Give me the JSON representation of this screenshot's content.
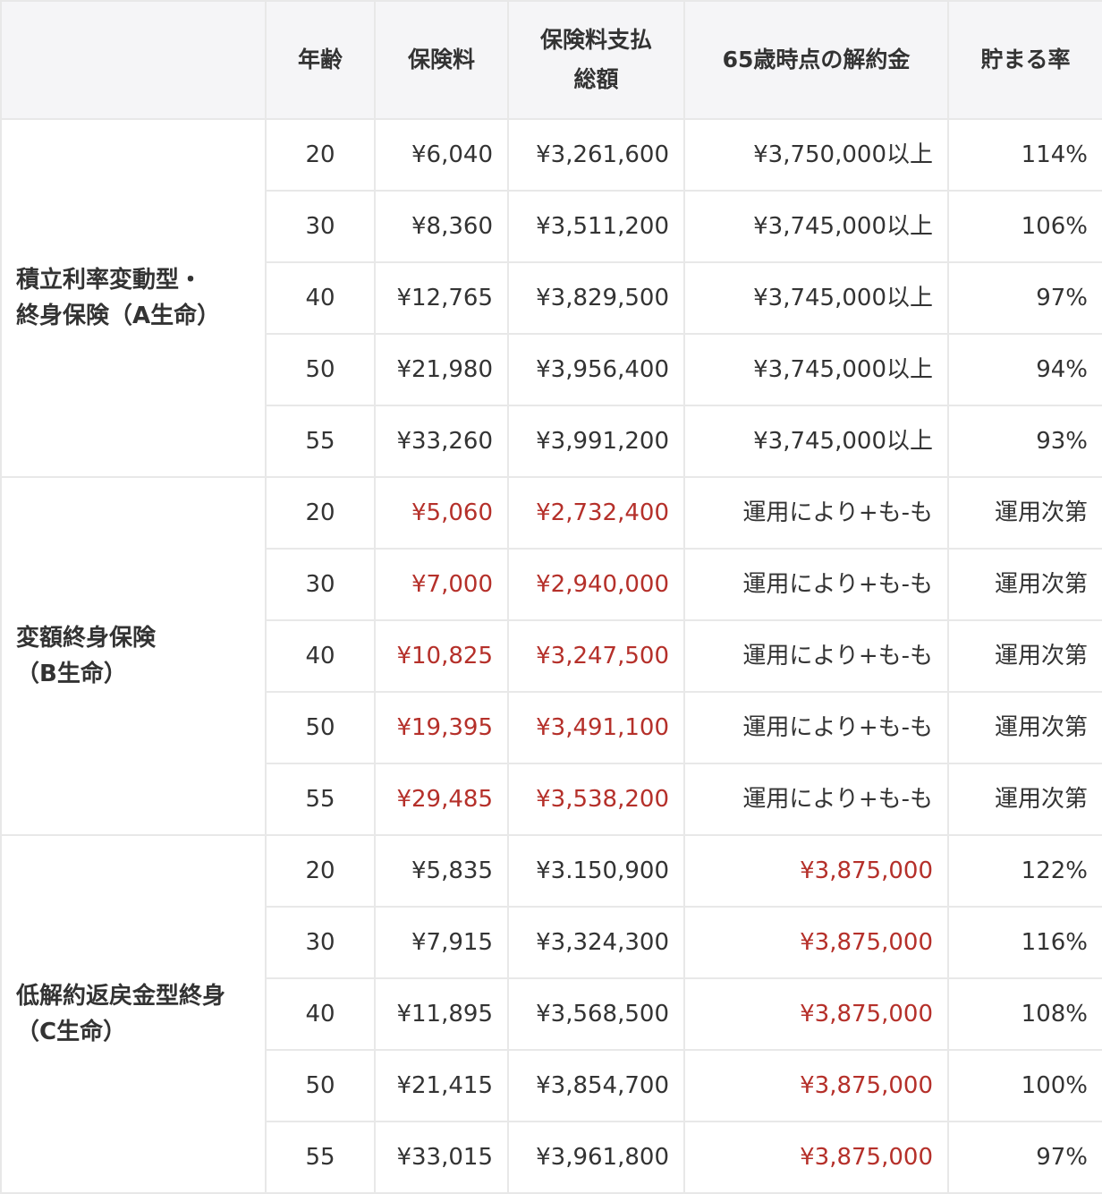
{
  "header": {
    "age": "年齢",
    "premium": "保険料",
    "total_line1": "保険料支払",
    "total_line2": "総額",
    "surrender": "65歳時点の解約金",
    "rate": "貯まる率"
  },
  "colors": {
    "text": "#333333",
    "highlight_red": "#b5302a",
    "header_bg": "#f5f5f7",
    "border": "#e8e8e8"
  },
  "groups": [
    {
      "name_line1": "積立利率変動型・",
      "name_line2": "終身保険（A生命）",
      "rows": [
        {
          "age": "20",
          "premium": "¥6,040",
          "total": "¥3,261,600",
          "surrender": "¥3,750,000以上",
          "rate": "114%"
        },
        {
          "age": "30",
          "premium": "¥8,360",
          "total": "¥3,511,200",
          "surrender": "¥3,745,000以上",
          "rate": "106%"
        },
        {
          "age": "40",
          "premium": "¥12,765",
          "total": "¥3,829,500",
          "surrender": "¥3,745,000以上",
          "rate": "97%"
        },
        {
          "age": "50",
          "premium": "¥21,980",
          "total": "¥3,956,400",
          "surrender": "¥3,745,000以上",
          "rate": "94%"
        },
        {
          "age": "55",
          "premium": "¥33,260",
          "total": "¥3,991,200",
          "surrender": "¥3,745,000以上",
          "rate": "93%"
        }
      ]
    },
    {
      "name_line1": "変額終身保険",
      "name_line2": "（B生命）",
      "rows": [
        {
          "age": "20",
          "premium": "¥5,060",
          "total": "¥2,732,400",
          "surrender": "運用により+も-も",
          "rate": "運用次第"
        },
        {
          "age": "30",
          "premium": "¥7,000",
          "total": "¥2,940,000",
          "surrender": "運用により+も-も",
          "rate": "運用次第"
        },
        {
          "age": "40",
          "premium": "¥10,825",
          "total": "¥3,247,500",
          "surrender": "運用により+も-も",
          "rate": "運用次第"
        },
        {
          "age": "50",
          "premium": "¥19,395",
          "total": "¥3,491,100",
          "surrender": "運用により+も-も",
          "rate": "運用次第"
        },
        {
          "age": "55",
          "premium": "¥29,485",
          "total": "¥3,538,200",
          "surrender": "運用により+も-も",
          "rate": "運用次第"
        }
      ]
    },
    {
      "name_line1": "低解約返戻金型終身",
      "name_line2": "（C生命）",
      "rows": [
        {
          "age": "20",
          "premium": "¥5,835",
          "total": "¥3.150,900",
          "surrender": "¥3,875,000",
          "rate": "122%"
        },
        {
          "age": "30",
          "premium": "¥7,915",
          "total": "¥3,324,300",
          "surrender": "¥3,875,000",
          "rate": "116%"
        },
        {
          "age": "40",
          "premium": "¥11,895",
          "total": "¥3,568,500",
          "surrender": "¥3,875,000",
          "rate": "108%"
        },
        {
          "age": "50",
          "premium": "¥21,415",
          "total": "¥3,854,700",
          "surrender": "¥3,875,000",
          "rate": "100%"
        },
        {
          "age": "55",
          "premium": "¥33,015",
          "total": "¥3,961,800",
          "surrender": "¥3,875,000",
          "rate": "97%"
        }
      ]
    }
  ]
}
